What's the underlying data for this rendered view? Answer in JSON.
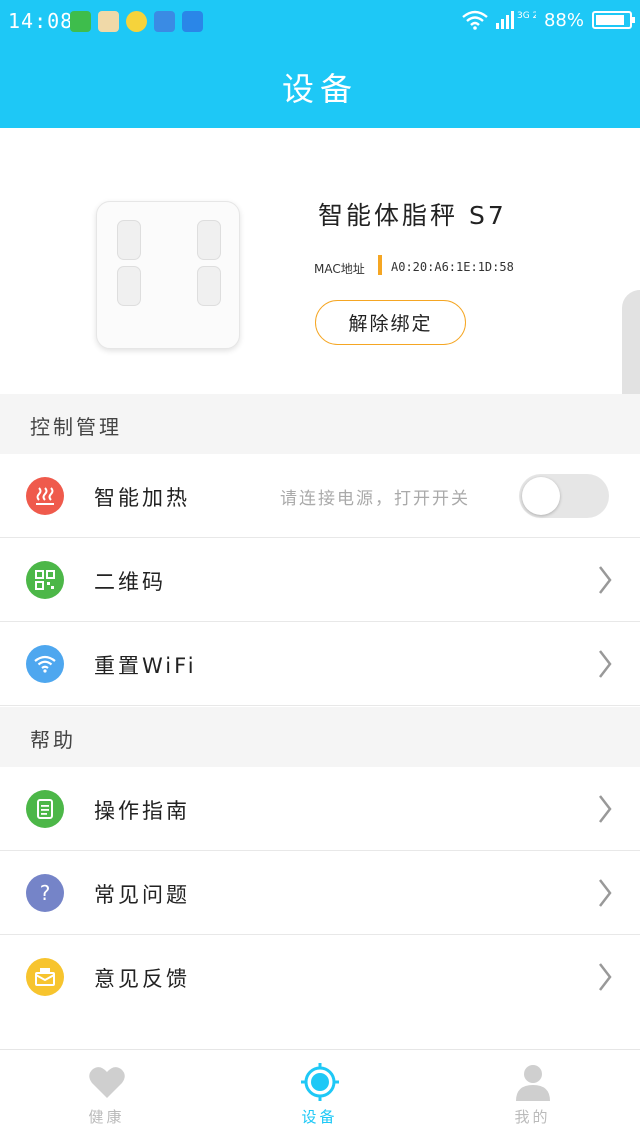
{
  "status": {
    "time": "14:08",
    "network": "3G 2G",
    "battery": "88%",
    "battery_level": 0.88
  },
  "header": {
    "title": "设备"
  },
  "device": {
    "name": "智能体脂秤 S7",
    "mac_label": "MAC地址",
    "mac_value": "A0:20:A6:1E:1D:58",
    "unbind_label": "解除绑定"
  },
  "control": {
    "title": "控制管理",
    "heating": {
      "label": "智能加热",
      "hint": "请连接电源，打开开关",
      "enabled": false
    },
    "qrcode": {
      "label": "二维码"
    },
    "wifi": {
      "label": "重置WiFi"
    }
  },
  "help": {
    "title": "帮助",
    "guide": {
      "label": "操作指南"
    },
    "faq": {
      "label": "常见问题"
    },
    "feedback": {
      "label": "意见反馈"
    }
  },
  "nav": {
    "health": "健康",
    "device": "设备",
    "mine": "我的"
  },
  "colors": {
    "primary": "#1ec8f6",
    "accent": "#f5a623",
    "heating": "#ef5a4c",
    "qrcode": "#4cb748",
    "wifi": "#4ea7ef",
    "guide": "#4cb748",
    "faq": "#7584c8",
    "feedback": "#f7c42e"
  }
}
